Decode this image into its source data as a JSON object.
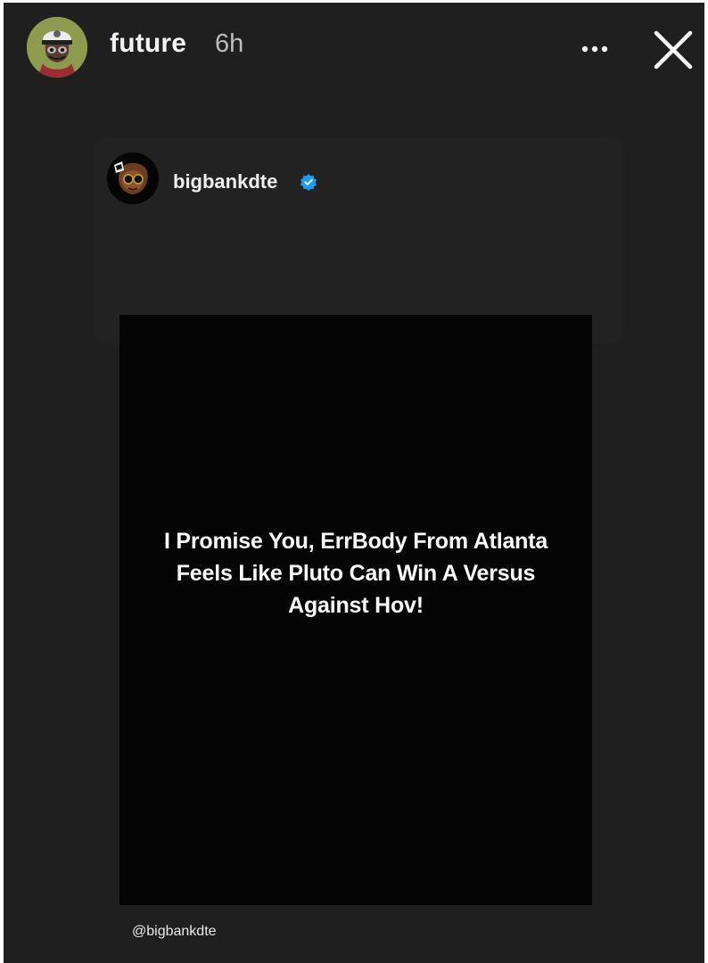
{
  "story": {
    "username": "future",
    "time_ago": "6h",
    "avatar_icon": "bored-ape-avatar-icon",
    "more_icon": "more-options-icon",
    "close_icon": "close-icon"
  },
  "shared_post": {
    "username": "bigbankdte",
    "verified": true,
    "avatar_icon": "profile-avatar-icon",
    "verified_icon": "verified-badge-icon",
    "image_text": "I Promise You, ErrBody From Atlanta Feels Like Pluto Can Win A Versus Against Hov!"
  },
  "mention": "@bigbankdte",
  "colors": {
    "background": "#1f1f1f",
    "card_background": "#222222",
    "post_image_background": "#050505",
    "verified_blue": "#1d9bf0",
    "text_primary": "#f3f3f3",
    "text_secondary": "#bdbdbd"
  }
}
